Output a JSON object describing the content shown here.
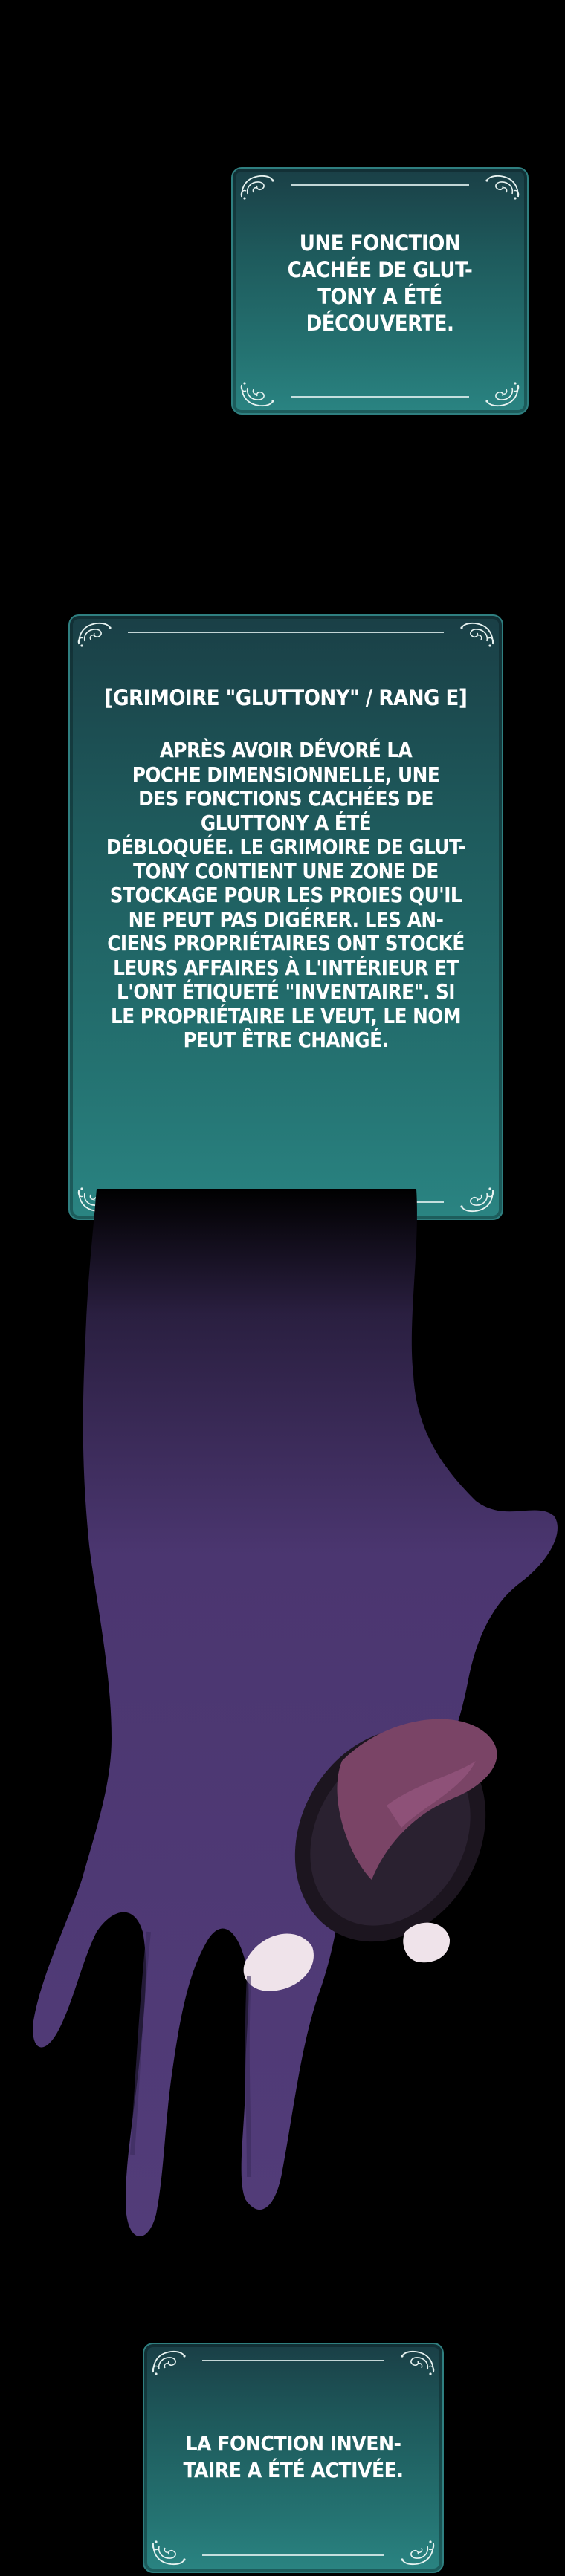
{
  "panels": {
    "top": {
      "text": "UNE FONCTION\nCACHÉE DE GLUT-\nTONY A ÉTÉ\nDÉCOUVERTE."
    },
    "middle": {
      "title": "[GRIMOIRE \"GLUTTONY\" / RANG E]",
      "body": "APRÈS AVOIR DÉVORÉ LA\nPOCHE DIMENSIONNELLE, UNE\nDES FONCTIONS CACHÉES DE\nGLUTTONY A ÉTÉ\nDÉBLOQUÉE. LE GRIMOIRE DE GLUT-\nTONY CONTIENT UNE ZONE DE\nSTOCKAGE POUR LES PROIES QU'IL\nNE PEUT PAS DIGÉRER. LES AN-\nCIENS PROPRIÉTAIRES ONT STOCKÉ\nLEURS AFFAIRES À L'INTÉRIEUR ET\nL'ONT ÉTIQUETÉ \"INVENTAIRE\". SI\nLE PROPRIÉTAIRE LE VEUT, LE NOM\nPEUT ÊTRE CHANGÉ."
    },
    "bottom": {
      "text": "LA FONCTION INVEN-\nTAIRE A ÉTÉ ACTIVÉE."
    }
  },
  "colors": {
    "background": "#000000",
    "panel_dark": "#1a3f46",
    "panel_light": "#2a8482",
    "hand": "#4b3670",
    "ring_dark": "#1c151f",
    "ring_mouth": "#7a4466",
    "ring_teeth": "#efe3ea"
  },
  "icons": {
    "corner_ornament": "filigree-corner-icon"
  }
}
